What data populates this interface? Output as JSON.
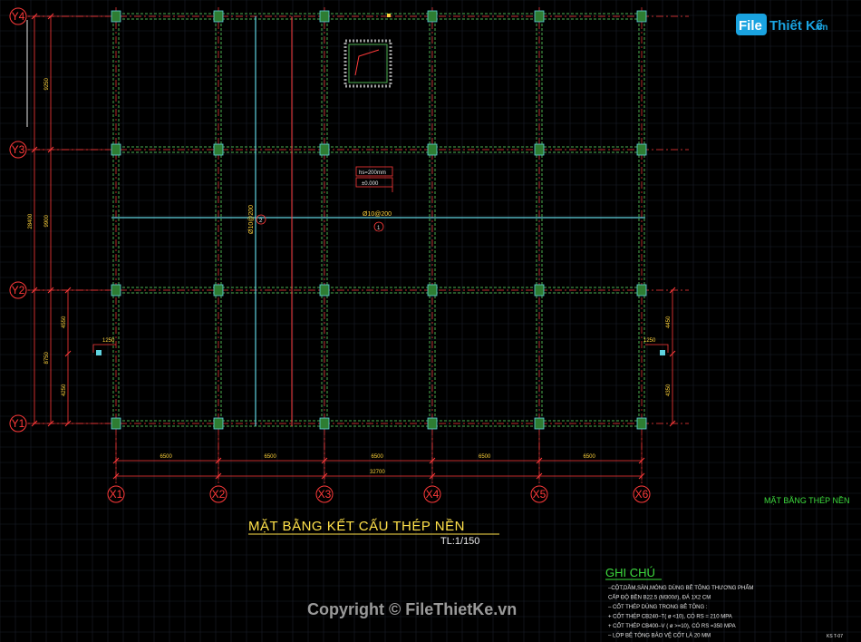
{
  "grid_axes": {
    "x": [
      "X1",
      "X2",
      "X3",
      "X4",
      "X5",
      "X6"
    ],
    "y": [
      "Y4",
      "Y3",
      "Y2",
      "Y1"
    ]
  },
  "dimensions": {
    "spans_x": [
      "6500",
      "6500",
      "6500",
      "6500",
      "6500"
    ],
    "total_x": "32700",
    "spans_y": [
      "9250",
      "9900",
      "8750"
    ],
    "total_y": "28400",
    "sub_left": [
      "4550",
      "4250"
    ],
    "sub_right": [
      "4450",
      "4350"
    ],
    "ext_left": "1250",
    "ext_right": "1250"
  },
  "annotations": {
    "rebar_1": "Ø10@200",
    "rebar_2": "Ø10@200",
    "tag_1": "1",
    "tag_2": "2",
    "slab_thickness": "hs=200mm",
    "elevation": "±0.000"
  },
  "title": {
    "main": "MẶT BẰNG  KẾT CẤU THÉP NỀN",
    "scale": "TL:1/150",
    "side_label": "MẶT BẰNG THÉP NỀN"
  },
  "notes": {
    "heading": "GHI CHÚ",
    "lines": [
      "–CỘT,DẦM,SÀN,MÓNG DÙNG BÊ TÔNG THƯƠNG PHẨM",
      "  CẤP ĐỘ BỀN B22.5 (M300#), ĐÁ 1X2 CM",
      "– CỐT THÉP DÙNG TRONG BÊ TÔNG :",
      "  + CỐT THÉP CB240–T( ø <10), CÓ RS = 210 MPA",
      "  + CỐT THÉP CB400–V ( ø >=10), CÓ RS =350 MPA",
      "– LỚP BÊ TÔNG BẢO VỆ CỐT LÀ 20 MM"
    ]
  },
  "watermark": {
    "logo_word_1": "File",
    "logo_word_2": "Thiết Kế",
    "logo_suffix": ".vn",
    "copyright": "Copyright © FileThietKe.vn"
  },
  "sheet_code": "KS T-07",
  "colors": {
    "background": "#000000",
    "grid_line": "#ff3a3a",
    "beam_green": "#4caf50",
    "rebar_cyan": "#5fd3e0",
    "title_yellow": "#ffe14a",
    "notes_green": "#3ddc3d",
    "dimension_red": "#ff3a3a"
  }
}
